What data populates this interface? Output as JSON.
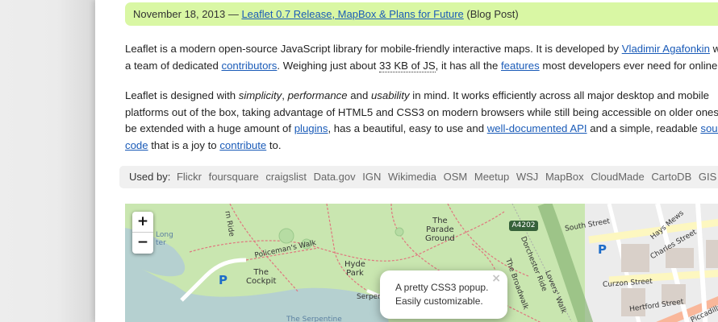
{
  "announcement": {
    "date": "November 18, 2013",
    "separator": "—",
    "link": "Leaflet 0.7 Release, MapBox & Plans for Future",
    "tag": "(Blog Post)"
  },
  "intro": {
    "t1": "Leaflet is a modern open-source JavaScript library for mobile-friendly interactive maps. It is developed by ",
    "author_link": "Vladimir Agafonkin",
    "t2": " with",
    "t3": "a team of dedicated ",
    "contributors_link": "contributors",
    "t4": ". Weighing just about ",
    "size": "33 KB of JS",
    "t5": ", it has all the ",
    "features_link": "features",
    "t6": " most developers ever need for online maps."
  },
  "design": {
    "t1": "Leaflet is designed with ",
    "em1": "simplicity",
    "c1": ", ",
    "em2": "performance",
    "c2": " and ",
    "em3": "usability",
    "t2": " in mind. It works efficiently across all major desktop and mobile",
    "t3": "platforms out of the box, taking advantage of HTML5 and CSS3 on modern browsers while still being accessible on older ones. It can",
    "t4": "be extended with a huge amount of ",
    "plugins_link": "plugins",
    "t5": ", has a beautiful, easy to use and ",
    "api_link": "well-documented API",
    "t6": " and a simple, readable ",
    "source_link": "source",
    "code_link": "code",
    "t7": " that is a joy to ",
    "contribute_link": "contribute",
    "t8": " to."
  },
  "used_by": {
    "label": "Used by:",
    "users": [
      "Flickr",
      "foursquare",
      "craigslist",
      "Data.gov",
      "IGN",
      "Wikimedia",
      "OSM",
      "Meetup",
      "WSJ",
      "MapBox",
      "CloudMade",
      "CartoDB",
      "GIS Cloud"
    ]
  },
  "map": {
    "zoom_in": "+",
    "zoom_out": "−",
    "popup_line1": "A pretty CSS3 popup.",
    "popup_line2": "Easily customizable.",
    "popup_close": "×",
    "labels": {
      "parade": "The\nParade\nGround",
      "hyde": "Hyde\nPark",
      "cockpit": "The\nCockpit",
      "policemans": "Policeman's Walk",
      "serpentine": "Serpen",
      "serpentine_lake": "The Serpentine",
      "a4202": "A4202",
      "south_street": "South Street",
      "hays_mews": "Hays Mews",
      "charles": "Charles Street",
      "curzon": "Curzon Street",
      "hertford": "Hertford Street",
      "piccadilly": "Piccadilly",
      "broadwalk": "The Broadwalk",
      "lovers": "Lovers' Walk",
      "dorchester": "Dorchester Ride",
      "p1": "P",
      "p2": "P",
      "long": "Long",
      "ter": "ter",
      "rn": "rn Ride"
    }
  }
}
